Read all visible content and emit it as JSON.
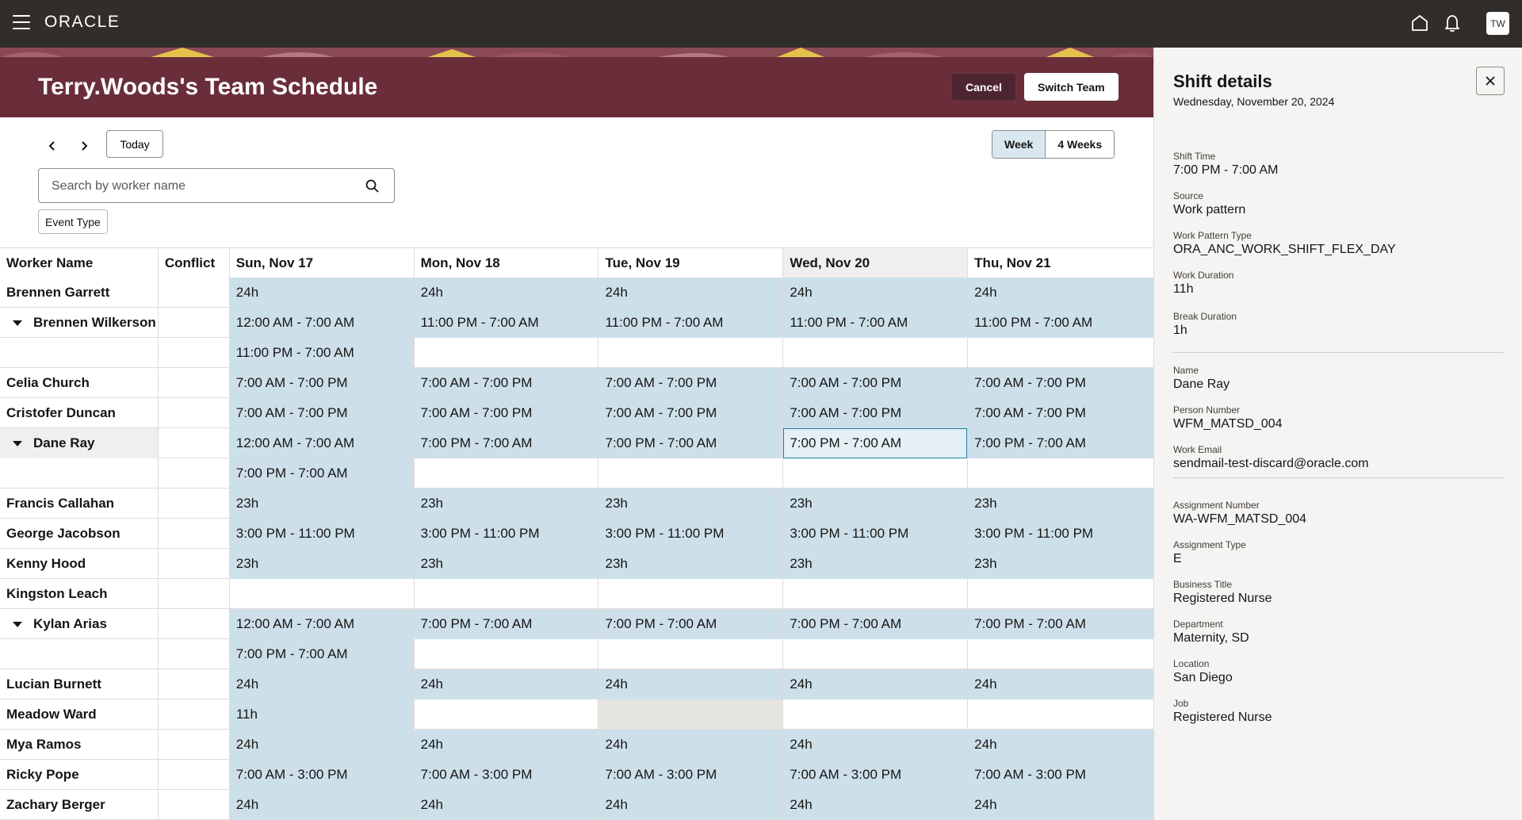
{
  "header": {
    "logo": "ORACLE",
    "avatar_initials": "TW"
  },
  "banner": {
    "title": "Terry.Woods's Team Schedule",
    "cancel_label": "Cancel",
    "switch_label": "Switch Team"
  },
  "toolbar": {
    "today_label": "Today",
    "view_week": "Week",
    "view_4weeks": "4 Weeks",
    "search_placeholder": "Search by worker name",
    "filter_chip": "Event Type"
  },
  "table": {
    "headers": [
      "Worker Name",
      "Conflict",
      "Sun, Nov 17",
      "Mon, Nov 18",
      "Tue, Nov 19",
      "Wed, Nov 20",
      "Thu, Nov 21"
    ],
    "rows": [
      {
        "name": "Brennen Garrett",
        "days": [
          "24h",
          "24h",
          "24h",
          "24h",
          "24h"
        ]
      },
      {
        "name": "Brennen Wilkerson",
        "days": [
          "12:00 AM - 7:00 AM",
          "11:00 PM - 7:00 AM",
          "11:00 PM - 7:00 AM",
          "11:00 PM - 7:00 AM",
          "11:00 PM - 7:00 AM"
        ]
      },
      {
        "name": "",
        "days": [
          "11:00 PM - 7:00 AM",
          "",
          "",
          "",
          ""
        ]
      },
      {
        "name": "Celia Church",
        "days": [
          "7:00 AM - 7:00 PM",
          "7:00 AM - 7:00 PM",
          "7:00 AM - 7:00 PM",
          "7:00 AM - 7:00 PM",
          "7:00 AM - 7:00 PM"
        ]
      },
      {
        "name": "Cristofer Duncan",
        "days": [
          "7:00 AM - 7:00 PM",
          "7:00 AM - 7:00 PM",
          "7:00 AM - 7:00 PM",
          "7:00 AM - 7:00 PM",
          "7:00 AM - 7:00 PM"
        ]
      },
      {
        "name": "Dane Ray",
        "days": [
          "12:00 AM - 7:00 AM",
          "7:00 PM - 7:00 AM",
          "7:00 PM - 7:00 AM",
          "7:00 PM - 7:00 AM",
          "7:00 PM - 7:00 AM"
        ]
      },
      {
        "name": "",
        "days": [
          "7:00 PM - 7:00 AM",
          "",
          "",
          "",
          ""
        ]
      },
      {
        "name": "Francis Callahan",
        "days": [
          "23h",
          "23h",
          "23h",
          "23h",
          "23h"
        ]
      },
      {
        "name": "George Jacobson",
        "days": [
          "3:00 PM - 11:00 PM",
          "3:00 PM - 11:00 PM",
          "3:00 PM - 11:00 PM",
          "3:00 PM - 11:00 PM",
          "3:00 PM - 11:00 PM"
        ]
      },
      {
        "name": "Kenny Hood",
        "days": [
          "23h",
          "23h",
          "23h",
          "23h",
          "23h"
        ]
      },
      {
        "name": "Kingston Leach",
        "days": [
          "",
          "",
          "",
          "",
          ""
        ]
      },
      {
        "name": "Kylan Arias",
        "days": [
          "12:00 AM - 7:00 AM",
          "7:00 PM - 7:00 AM",
          "7:00 PM - 7:00 AM",
          "7:00 PM - 7:00 AM",
          "7:00 PM - 7:00 AM"
        ]
      },
      {
        "name": "",
        "days": [
          "7:00 PM - 7:00 AM",
          "",
          "",
          "",
          ""
        ]
      },
      {
        "name": "Lucian Burnett",
        "days": [
          "24h",
          "24h",
          "24h",
          "24h",
          "24h"
        ]
      },
      {
        "name": "Meadow Ward",
        "days": [
          "11h",
          "",
          "",
          "",
          ""
        ]
      },
      {
        "name": "Mya Ramos",
        "days": [
          "24h",
          "24h",
          "24h",
          "24h",
          "24h"
        ]
      },
      {
        "name": "Ricky Pope",
        "days": [
          "7:00 AM - 3:00 PM",
          "7:00 AM - 3:00 PM",
          "7:00 AM - 3:00 PM",
          "7:00 AM - 3:00 PM",
          "7:00 AM - 3:00 PM"
        ]
      },
      {
        "name": "Zachary Berger",
        "days": [
          "24h",
          "24h",
          "24h",
          "24h",
          "24h"
        ]
      }
    ]
  },
  "panel": {
    "title": "Shift details",
    "date": "Wednesday, November 20, 2024",
    "fields": [
      {
        "label": "Shift Time",
        "value": "7:00 PM - 7:00 AM"
      },
      {
        "label": "Source",
        "value": "Work pattern"
      },
      {
        "label": "Work Pattern Type",
        "value": "ORA_ANC_WORK_SHIFT_FLEX_DAY"
      },
      {
        "label": "Work Duration",
        "value": "11h"
      },
      {
        "label": "Break Duration",
        "value": "1h"
      },
      {
        "label": "Name",
        "value": "Dane Ray"
      },
      {
        "label": "Person Number",
        "value": "WFM_MATSD_004"
      },
      {
        "label": "Work Email",
        "value": "sendmail-test-discard@oracle.com"
      },
      {
        "label": "Assignment Number",
        "value": "WA-WFM_MATSD_004"
      },
      {
        "label": "Assignment Type",
        "value": "E"
      },
      {
        "label": "Business Title",
        "value": "Registered Nurse"
      },
      {
        "label": "Department",
        "value": "Maternity, SD"
      },
      {
        "label": "Location",
        "value": "San Diego"
      },
      {
        "label": "Job",
        "value": "Registered Nurse"
      }
    ]
  },
  "colors": {
    "topbar": "#312d2a",
    "banner": "#6a2e3a",
    "shift_fill": "#cde0ea",
    "panel_bg": "#f5f4f2"
  }
}
